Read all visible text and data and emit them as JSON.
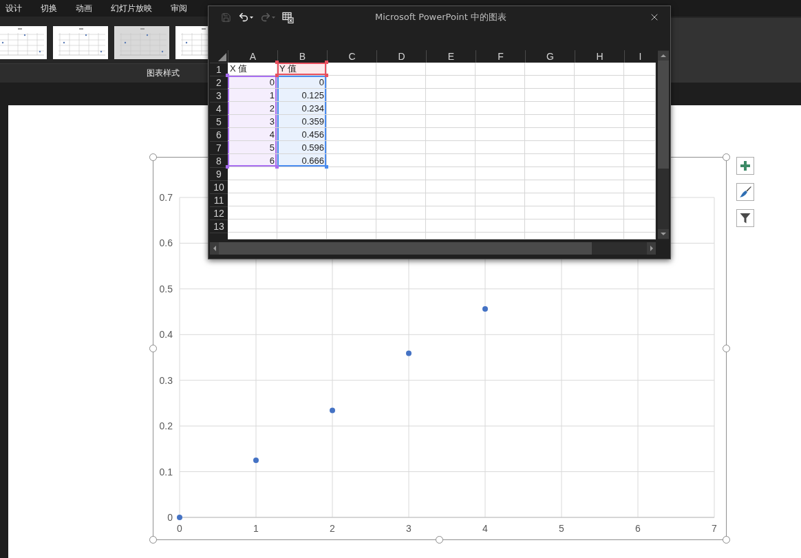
{
  "menu_tabs": [
    {
      "label": "设计",
      "selected": false
    },
    {
      "label": "切换",
      "selected": false
    },
    {
      "label": "动画",
      "selected": false
    },
    {
      "label": "幻灯片放映",
      "selected": false
    },
    {
      "label": "审阅",
      "selected": false
    }
  ],
  "ribbon": {
    "style_gallery": [
      {
        "shaded": false
      },
      {
        "shaded": false
      },
      {
        "shaded": true
      },
      {
        "shaded": false
      }
    ],
    "group_label": "图表样式"
  },
  "chart": {
    "selected": true,
    "chart_data": {
      "type": "scatter",
      "x": [
        0,
        1,
        2,
        3,
        4
      ],
      "series": [
        {
          "color": "#4472c4",
          "values": [
            0,
            0.125,
            0.234,
            0.359,
            0.456
          ]
        }
      ],
      "xlim": [
        0,
        7
      ],
      "ylim": [
        0,
        0.7
      ],
      "xticks": [
        0,
        1,
        2,
        3,
        4,
        5,
        6,
        7
      ],
      "yticks": [
        0,
        0.1,
        0.2,
        0.3,
        0.4,
        0.5,
        0.6,
        0.7
      ],
      "grid": true
    },
    "side_buttons": [
      {
        "kind": "add"
      },
      {
        "kind": "style"
      },
      {
        "kind": "filter"
      }
    ]
  },
  "data_window": {
    "title": "Microsoft PowerPoint 中的图表",
    "toolbar": [
      {
        "kind": "save",
        "disabled": true
      },
      {
        "kind": "undo",
        "disabled": false
      },
      {
        "kind": "redo",
        "disabled": true
      },
      {
        "kind": "edit_in_excel",
        "disabled": false
      }
    ],
    "columns": [
      "A",
      "B",
      "C",
      "D",
      "E",
      "F",
      "G",
      "H",
      "I"
    ],
    "ranges": [
      {
        "kind": "x_values",
        "color": "#a86ef0"
      },
      {
        "kind": "series_name",
        "color": "#e8505f"
      },
      {
        "kind": "y_values",
        "color": "#4a8cf0"
      }
    ],
    "rows": [
      {
        "header": "1",
        "kind": "labels",
        "cells": [
          {
            "text": "X 值",
            "kind": "plain"
          },
          {
            "text": "Y 值",
            "kind": "series_name"
          }
        ]
      },
      {
        "header": "2",
        "kind": "values",
        "cells": [
          {
            "text": "0",
            "kind": "x_values"
          },
          {
            "text": "0",
            "kind": "y_values"
          }
        ]
      },
      {
        "header": "3",
        "kind": "values",
        "cells": [
          {
            "text": "1",
            "kind": "x_values"
          },
          {
            "text": "0.125",
            "kind": "y_values"
          }
        ]
      },
      {
        "header": "4",
        "kind": "values",
        "cells": [
          {
            "text": "2",
            "kind": "x_values"
          },
          {
            "text": "0.234",
            "kind": "y_values"
          }
        ]
      },
      {
        "header": "5",
        "kind": "values",
        "cells": [
          {
            "text": "3",
            "kind": "x_values"
          },
          {
            "text": "0.359",
            "kind": "y_values"
          }
        ]
      },
      {
        "header": "6",
        "kind": "values",
        "cells": [
          {
            "text": "4",
            "kind": "x_values"
          },
          {
            "text": "0.456",
            "kind": "y_values"
          }
        ]
      },
      {
        "header": "7",
        "kind": "values",
        "cells": [
          {
            "text": "5",
            "kind": "x_values"
          },
          {
            "text": "0.596",
            "kind": "y_values"
          }
        ]
      },
      {
        "header": "8",
        "kind": "values",
        "cells": [
          {
            "text": "6",
            "kind": "x_values"
          },
          {
            "text": "0.666",
            "kind": "y_values"
          }
        ]
      },
      {
        "header": "9",
        "kind": "empty"
      },
      {
        "header": "10",
        "kind": "empty"
      },
      {
        "header": "11",
        "kind": "empty"
      },
      {
        "header": "12",
        "kind": "empty"
      },
      {
        "header": "13",
        "kind": "empty"
      }
    ]
  }
}
